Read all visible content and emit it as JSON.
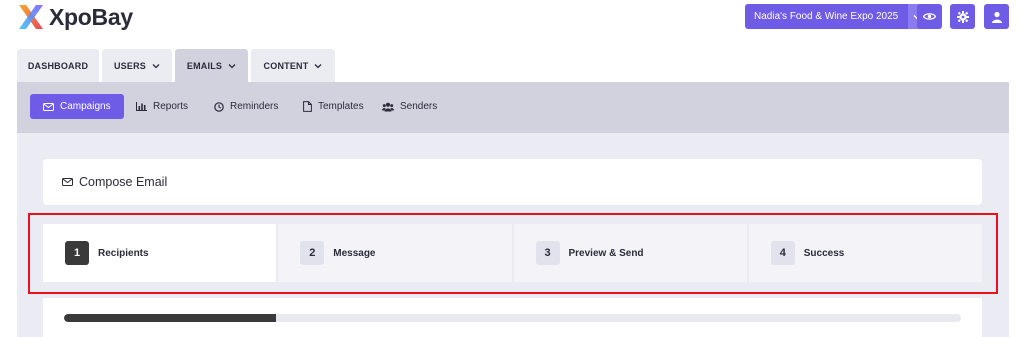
{
  "header": {
    "logo_text": "XpoBay",
    "expo_selector": "Nadia's Food & Wine Expo 2025",
    "icons": [
      "eye-icon",
      "gear-icon",
      "user-icon"
    ]
  },
  "main_nav": [
    {
      "label": "DASHBOARD",
      "has_dropdown": false
    },
    {
      "label": "USERS",
      "has_dropdown": true
    },
    {
      "label": "EMAILS",
      "has_dropdown": true,
      "active": true
    },
    {
      "label": "CONTENT",
      "has_dropdown": true
    }
  ],
  "sub_nav": [
    {
      "label": "Campaigns",
      "icon": "envelope-icon",
      "active": true
    },
    {
      "label": "Reports",
      "icon": "bar-chart-icon"
    },
    {
      "label": "Reminders",
      "icon": "clock-icon"
    },
    {
      "label": "Templates",
      "icon": "file-icon"
    },
    {
      "label": "Senders",
      "icon": "users-icon"
    }
  ],
  "compose": {
    "title": "Compose Email"
  },
  "steps": [
    {
      "number": "1",
      "label": "Recipients",
      "active": true
    },
    {
      "number": "2",
      "label": "Message"
    },
    {
      "number": "3",
      "label": "Preview & Send"
    },
    {
      "number": "4",
      "label": "Success"
    }
  ],
  "progress": {
    "fraction": 0.236
  },
  "colors": {
    "accent": "#6e5be6",
    "highlight": "#e8131b",
    "active_step": "#3a3a3a"
  }
}
